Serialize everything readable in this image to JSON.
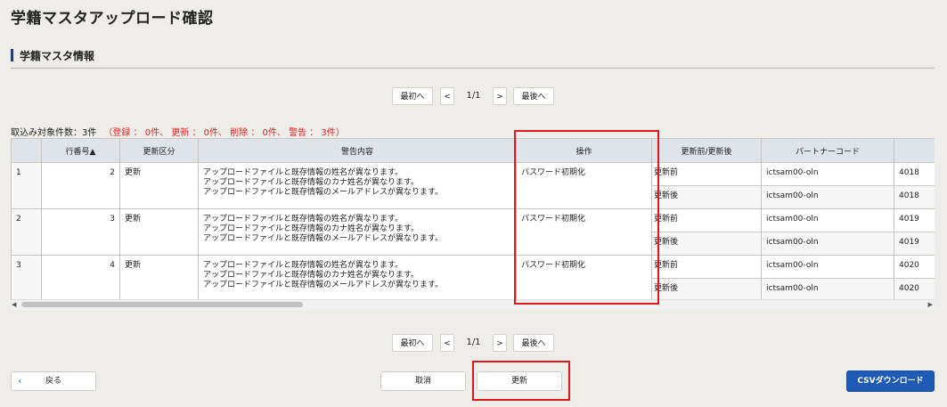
{
  "page": {
    "title": "学籍マスタアップロード確認"
  },
  "section": {
    "title": "学籍マスタ情報"
  },
  "pager": {
    "first": "最初へ",
    "prev": "<",
    "info": "1/1",
    "next": ">",
    "last": "最後へ"
  },
  "summary": {
    "count": "取込み対象件数：3件",
    "detail": "（登録 ： 0件、 更新 ： 0件、 削除 ： 0件、 警告 ： 3件）"
  },
  "table": {
    "headers": [
      "",
      "行番号▲",
      "更新区分",
      "警告内容",
      "操作",
      "更新前/更新後",
      "パートナーコード",
      ""
    ],
    "rows": [
      {
        "no": "1",
        "line": "2",
        "kubun": "更新",
        "warnings": [
          "アップロードファイルと既存情報の姓名が異なります。",
          "アップロードファイルと既存情報のカナ姓名が異なります。",
          "アップロードファイルと既存情報のメールアドレスが異なります。"
        ],
        "op": "パスワード初期化",
        "before": "更新前",
        "after": "更新後",
        "partner_before": "ictsam00-oln",
        "partner_after": "ictsam00-oln",
        "code_before": "4018",
        "code_after": "4018"
      },
      {
        "no": "2",
        "line": "3",
        "kubun": "更新",
        "warnings": [
          "アップロードファイルと既存情報の姓名が異なります。",
          "アップロードファイルと既存情報のカナ姓名が異なります。",
          "アップロードファイルと既存情報のメールアドレスが異なります。"
        ],
        "op": "パスワード初期化",
        "before": "更新前",
        "after": "更新後",
        "partner_before": "ictsam00-oln",
        "partner_after": "ictsam00-oln",
        "code_before": "4019",
        "code_after": "4019"
      },
      {
        "no": "3",
        "line": "4",
        "kubun": "更新",
        "warnings": [
          "アップロードファイルと既存情報の姓名が異なります。",
          "アップロードファイルと既存情報のカナ姓名が異なります。",
          "アップロードファイルと既存情報のメールアドレスが異なります。"
        ],
        "op": "パスワード初期化",
        "before": "更新前",
        "after": "更新後",
        "partner_before": "ictsam00-oln",
        "partner_after": "ictsam00-oln",
        "code_before": "4020",
        "code_after": "4020"
      }
    ]
  },
  "buttons": {
    "back": "戻る",
    "cancel": "取消",
    "update": "更新",
    "csv": "CSVダウンロード"
  },
  "icons": {
    "back": "chevron-left-icon",
    "scroll_left": "triangle-left-icon",
    "scroll_right": "triangle-right-icon"
  },
  "colors": {
    "accent": "#1f5bb4",
    "highlight": "#e01818",
    "warning_text": "#e02020",
    "section_bar": "#243a7a"
  }
}
